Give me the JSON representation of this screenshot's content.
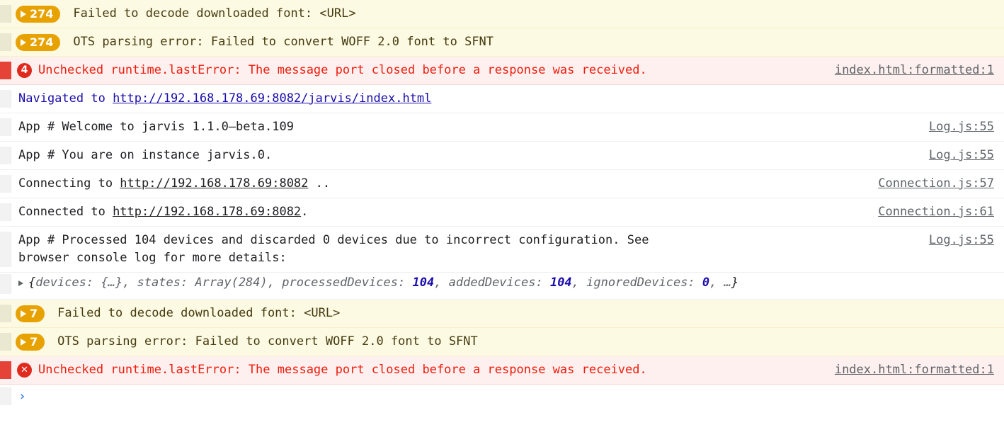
{
  "console": {
    "prompt": {
      "chevron": "›",
      "value": "",
      "placeholder": ""
    },
    "rows": [
      {
        "kind": "warning",
        "badge_count": "274",
        "message": "Failed to decode downloaded font: <URL>",
        "source": ""
      },
      {
        "kind": "warning",
        "badge_count": "274",
        "message": "OTS parsing error: Failed to convert WOFF 2.0 font to SFNT",
        "source": ""
      },
      {
        "kind": "error",
        "badge_count": "4",
        "message": "Unchecked runtime.lastError: The message port closed before a response was received.",
        "source": "index.html:formatted:1"
      },
      {
        "kind": "navigation",
        "prefix": "Navigated to ",
        "url": "http://192.168.178.69:8082/jarvis/index.html",
        "source": ""
      },
      {
        "kind": "log",
        "message": "App # Welcome to jarvis 1.1.0–beta.109",
        "source": "Log.js:55"
      },
      {
        "kind": "log",
        "message": "App # You are on instance jarvis.0.",
        "source": "Log.js:55"
      },
      {
        "kind": "log-url",
        "prefix": "Connecting to ",
        "url": "http://192.168.178.69:8082",
        "suffix": " ..",
        "source": "Connection.js:57"
      },
      {
        "kind": "log-url",
        "prefix": "Connected to ",
        "url": "http://192.168.178.69:8082",
        "suffix": ".",
        "source": "Connection.js:61"
      },
      {
        "kind": "log-multiline",
        "message": "App # Processed 104 devices and discarded 0 devices due to incorrect configuration. See\nbrowser console log for more details:",
        "source": "Log.js:55"
      },
      {
        "kind": "object-preview",
        "arrow": "▸",
        "parts": [
          {
            "text": "{",
            "style": "brace"
          },
          {
            "text": "devices: {…}, states: Array(284), processedDevices: ",
            "style": "key"
          },
          {
            "text": "104",
            "style": "num"
          },
          {
            "text": ", addedDevices: ",
            "style": "key"
          },
          {
            "text": "104",
            "style": "num"
          },
          {
            "text": ", ignoredDevices: ",
            "style": "key"
          },
          {
            "text": "0",
            "style": "num"
          },
          {
            "text": ", …",
            "style": "key"
          },
          {
            "text": "}",
            "style": "brace"
          }
        ],
        "source": ""
      },
      {
        "kind": "warning",
        "badge_count": "7",
        "message": "Failed to decode downloaded font: <URL>",
        "source": ""
      },
      {
        "kind": "warning",
        "badge_count": "7",
        "message": "OTS parsing error: Failed to convert WOFF 2.0 font to SFNT",
        "source": ""
      },
      {
        "kind": "error",
        "badge_icon": "✕",
        "message": "Unchecked runtime.lastError: The message port closed before a response was received.",
        "source": "index.html:formatted:1"
      }
    ]
  },
  "colors": {
    "warning_bg": "#fdfae3",
    "warning_badge": "#e8a200",
    "error_bg": "#fdf0ef",
    "error_text": "#f01b0c",
    "error_badge": "#e02a1d",
    "link_blue": "#1a0dab",
    "prompt_blue": "#4285f4",
    "source_gray": "#5f6368"
  }
}
